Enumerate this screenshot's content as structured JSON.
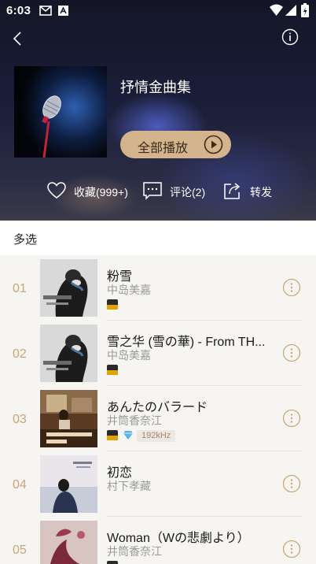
{
  "status_bar": {
    "time": "6:03"
  },
  "header": {
    "album_title": "抒情金曲集",
    "play_all_label": "全部播放",
    "actions": {
      "favorite_label": "收藏(999+)",
      "comment_label": "评论(2)",
      "share_label": "转发"
    }
  },
  "multi_select": {
    "label": "多选"
  },
  "songs": [
    {
      "index": "01",
      "title": "粉雪",
      "artist": "中岛美嘉",
      "tags": [
        "hr"
      ],
      "khz": ""
    },
    {
      "index": "02",
      "title": "雪之华 (雪の華) - From TH...",
      "artist": "中岛美嘉",
      "tags": [
        "hr"
      ],
      "khz": ""
    },
    {
      "index": "03",
      "title": "あんたのバラード",
      "artist": "井筒香奈江",
      "tags": [
        "hr",
        "diamond"
      ],
      "khz": "192kHz"
    },
    {
      "index": "04",
      "title": "初恋",
      "artist": "村下孝藏",
      "tags": [],
      "khz": ""
    },
    {
      "index": "05",
      "title": "Woman（Wの悲劇より）",
      "artist": "井筒香奈江",
      "tags": [
        "hr"
      ],
      "khz": ""
    }
  ],
  "colors": {
    "accent_gold": "#d4b48c",
    "index_color": "#c8a676",
    "list_bg": "#f7f5f2"
  },
  "icons": {
    "back": "chevron-left-icon",
    "info": "info-icon",
    "play": "play-circle-icon",
    "favorite": "heart-icon",
    "comment": "comment-icon",
    "share": "share-icon",
    "more": "more-vertical-icon"
  }
}
